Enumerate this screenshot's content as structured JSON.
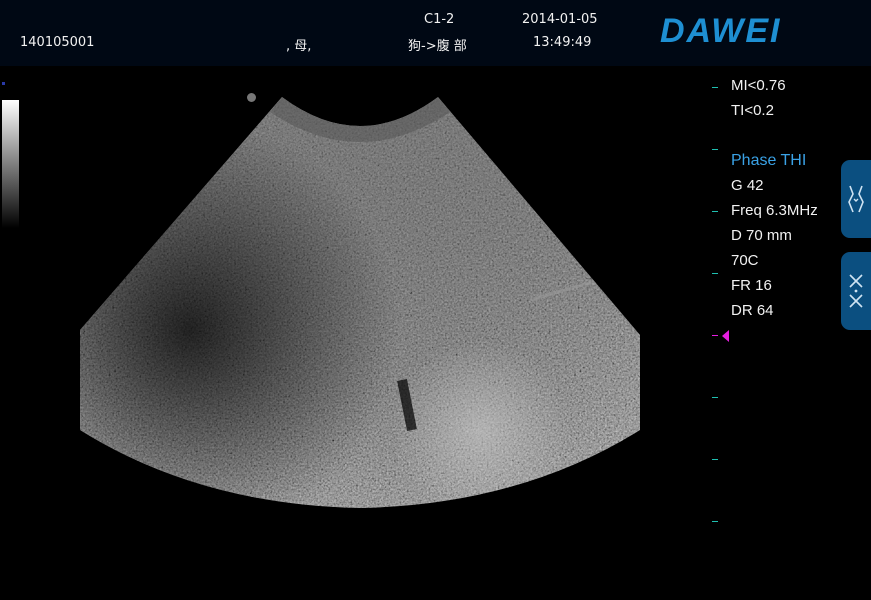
{
  "header": {
    "patient_id": "140105001",
    "patient_info": ", 母,",
    "probe": "C1-2",
    "exam": "狗->腹 部",
    "date": "2014-01-05",
    "time": "13:49:49",
    "brand": "DAWEI"
  },
  "params": {
    "mi": "MI<0.76",
    "ti": "TI<0.2",
    "mode": "Phase THI",
    "gain": "G 42",
    "freq": "Freq 6.3MHz",
    "depth": "D 70 mm",
    "preset": "70C",
    "frame_rate": "FR 16",
    "dynamic_range": "DR 64"
  },
  "colors": {
    "accent": "#3aa2e6",
    "brand": "#1e8fd2",
    "depth_ticks": "#1fbfb0",
    "focus_marker": "#e61ee0",
    "side_button": "#0b4f80"
  },
  "icons": {
    "side_button_1": "body-marker-icon",
    "side_button_2": "collapse-arrows-icon"
  }
}
